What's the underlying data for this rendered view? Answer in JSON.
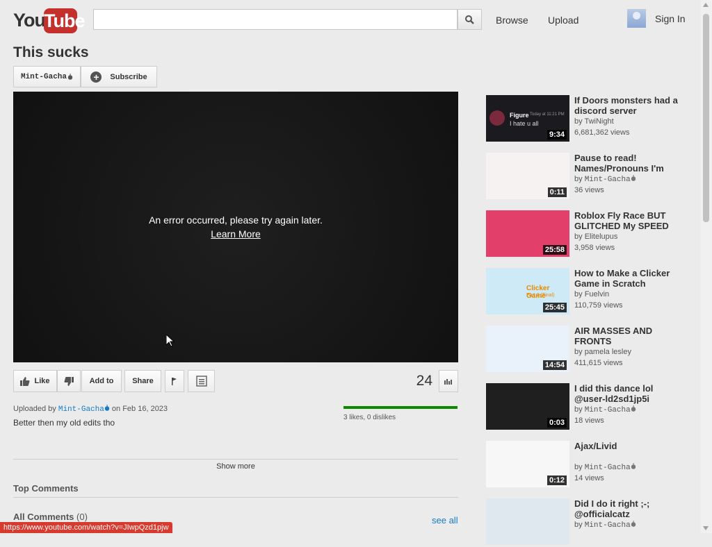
{
  "header": {
    "logo_you": "You",
    "logo_tube": "Tube",
    "search_placeholder": "",
    "browse": "Browse",
    "upload": "Upload",
    "sign_in": "Sign In"
  },
  "video": {
    "title": "This sucks",
    "channel": "Mint-Gacha",
    "subscribe": "Subscribe",
    "error_message": "An error occurred, please try again later.",
    "learn_more": "Learn More",
    "view_count": "24",
    "uploaded_by_prefix": "Uploaded by",
    "uploaded_on": "on Feb 16, 2023",
    "description": "Better then my old edits tho",
    "likes_text": "3 likes, 0 dislikes",
    "like_ratio": 1.0,
    "show_more": "Show more"
  },
  "actions": {
    "like": "Like",
    "add_to": "Add to",
    "share": "Share"
  },
  "comments": {
    "top_comments": "Top Comments",
    "all_comments": "All Comments",
    "count": "(0)",
    "see_all": "see all"
  },
  "status_bar": "https://www.youtube.com/watch?v=JIwpQzd1pjw",
  "sidebar": [
    {
      "title": "If Doors monsters had a discord server",
      "by": "by",
      "channel": "TwiNight",
      "views": "6,681,362 views",
      "duration": "9:34",
      "thumb_color": "#1a1a1f",
      "thumb_text_name": "Figure",
      "thumb_text_time": "Today at 11:21 PM",
      "thumb_text_msg": "I hate u all"
    },
    {
      "title": "Pause to read! Names/Pronouns I'm",
      "by": "by",
      "channel": "Mint-Gacha",
      "views": "36 views",
      "duration": "0:11",
      "thumb_color": "#f6f2f2"
    },
    {
      "title": "Roblox Fly Race BUT GLITCHED My SPEED",
      "by": "by",
      "channel": "Elitelupus",
      "views": "3,958 views",
      "duration": "25:58",
      "thumb_color": "#e2406b"
    },
    {
      "title": "How to Make a Clicker Game in Scratch",
      "by": "by",
      "channel": "Fuelvin",
      "views": "110,759 views",
      "duration": "25:45",
      "thumb_color": "#cfeaf7",
      "thumb_text_name": "Clicker Game",
      "thumb_text_msg": "Part 2 (Final)"
    },
    {
      "title": "AIR MASSES AND FRONTS",
      "by": "by",
      "channel": "pamela lesley",
      "views": "411,615 views",
      "duration": "14:54",
      "thumb_color": "#e9f2fb"
    },
    {
      "title": "I did this dance lol @user-ld2sd1jp5i",
      "by": "by",
      "channel": "Mint-Gacha",
      "views": "18 views",
      "duration": "0:03",
      "thumb_color": "#1f1f1f"
    },
    {
      "title": "Ajax/Livid",
      "by": "by",
      "channel": "Mint-Gacha",
      "views": "14 views",
      "duration": "0:12",
      "thumb_color": "#f7f7f7"
    },
    {
      "title": "Did I do it right ;-; @officialcatz",
      "by": "by",
      "channel": "Mint-Gacha",
      "views": "",
      "duration": "",
      "thumb_color": "#dfe7ef"
    }
  ]
}
